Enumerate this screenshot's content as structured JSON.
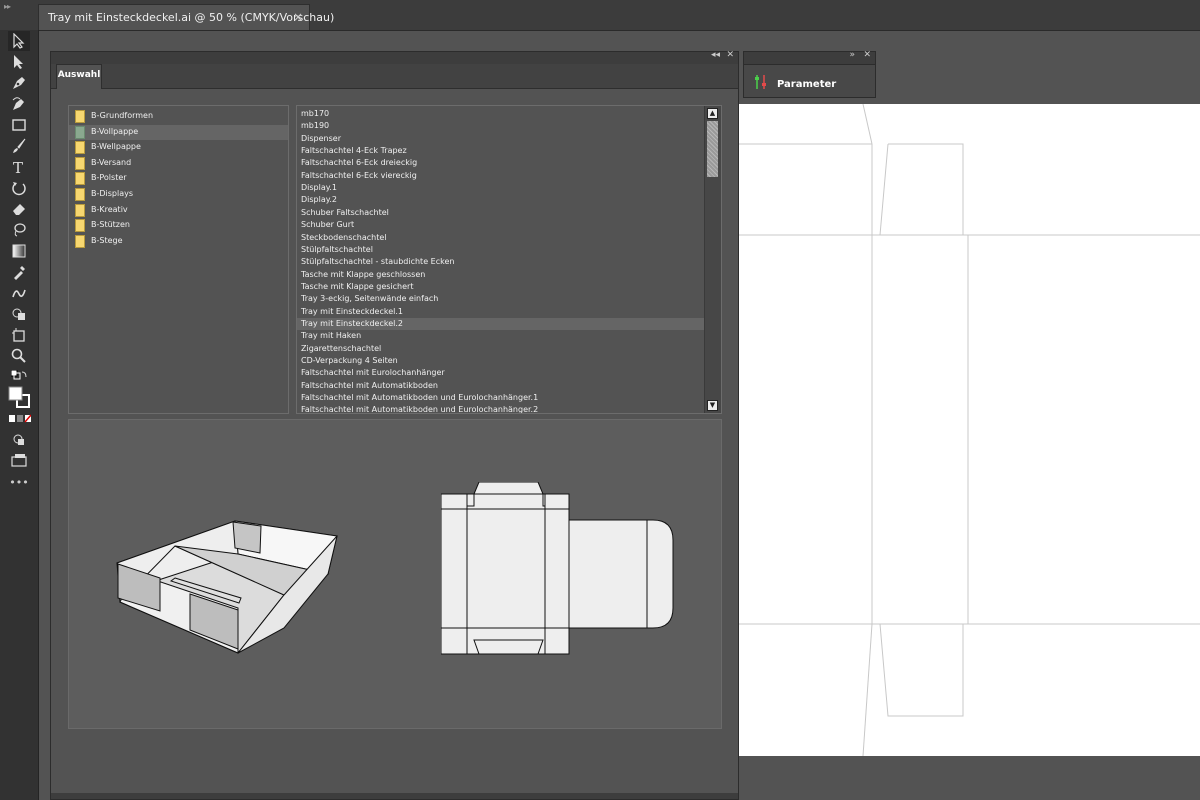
{
  "document_tab": {
    "title": "Tray mit Einsteckdeckel.ai @ 50 % (CMYK/Vorschau)",
    "close": "×"
  },
  "main_panel": {
    "header": {
      "collapse": "◂◂",
      "close": "✕"
    },
    "tab": "Auswahl",
    "categories": [
      {
        "label": "B-Grundformen"
      },
      {
        "label": "B-Vollpappe"
      },
      {
        "label": "B-Wellpappe"
      },
      {
        "label": "B-Versand"
      },
      {
        "label": "B-Polster"
      },
      {
        "label": "B-Displays"
      },
      {
        "label": "B-Kreativ"
      },
      {
        "label": "B-Stützen"
      },
      {
        "label": "B-Stege"
      }
    ],
    "selected_category": "B-Vollpappe",
    "items": [
      "mb170",
      "mb190",
      "Dispenser",
      "Faltschachtel 4-Eck Trapez",
      "Faltschachtel 6-Eck dreieckig",
      "Faltschachtel 6-Eck viereckig",
      "Display.1",
      "Display.2",
      "Schuber Faltschachtel",
      "Schuber Gurt",
      "Steckbodenschachtel",
      "Stülpfaltschachtel",
      "Stülpfaltschachtel - staubdichte Ecken",
      "Tasche mit Klappe geschlossen",
      "Tasche mit Klappe gesichert",
      "Tray 3-eckig, Seitenwände einfach",
      "Tray mit Einsteckdeckel.1",
      "Tray mit Einsteckdeckel.2",
      "Tray mit Haken",
      "Zigarettenschachtel",
      "CD-Verpackung 4 Seiten",
      "Faltschachtel mit Eurolochanhänger",
      "Faltschachtel mit Automatikboden",
      "Faltschachtel mit Automatikboden und Eurolochanhänger.1",
      "Faltschachtel mit Automatikboden und Eurolochanhänger.2"
    ],
    "selected_item": "Tray mit Einsteckdeckel.2",
    "scroll_up": "▲",
    "scroll_down": "▼"
  },
  "parameter_panel": {
    "label": "Parameter",
    "collapse": "»",
    "close": "✕"
  },
  "toolbar": {
    "tools": [
      "selection-tool-icon",
      "direct-selection-tool-icon",
      "pen-tool-icon",
      "curvature-tool-icon",
      "rectangle-tool-icon",
      "paintbrush-tool-icon",
      "type-tool-icon",
      "rotate-tool-icon",
      "eraser-tool-icon",
      "lasso-tool-icon",
      "gradient-tool-icon",
      "eyedropper-tool-icon",
      "blend-tool-icon",
      "shape-builder-tool-icon",
      "artboard-tool-icon",
      "zoom-tool-icon"
    ],
    "more": "•••"
  },
  "colors": {
    "folder": "#f7d770",
    "selected_folder": "#8aa88f",
    "artboard": "#ffffff",
    "ui_dark": "#323232"
  }
}
